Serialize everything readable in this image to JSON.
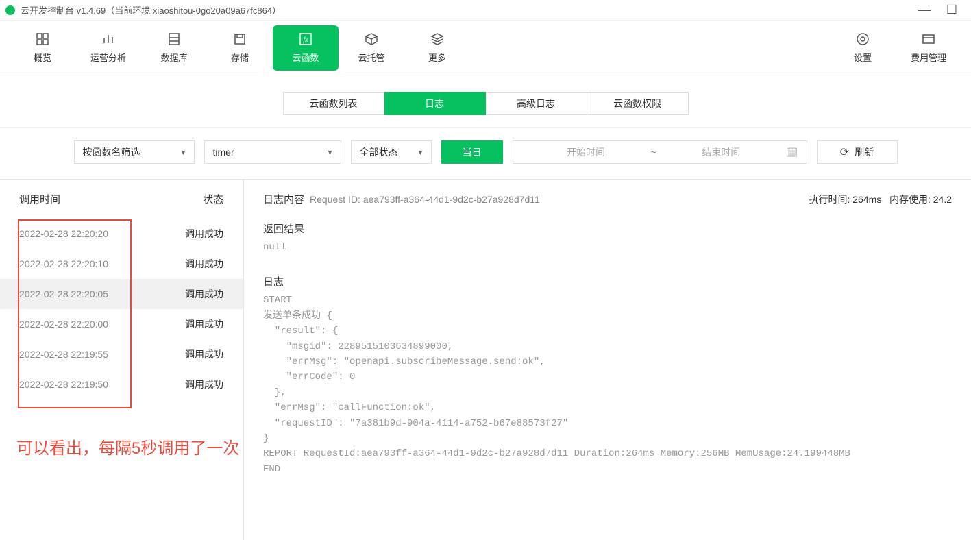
{
  "window": {
    "title": "云开发控制台 v1.4.69（当前环境 xiaoshitou-0go20a09a67fc864）"
  },
  "toolbar": {
    "items": [
      {
        "label": "概览",
        "icon": "grid"
      },
      {
        "label": "运营分析",
        "icon": "bars"
      },
      {
        "label": "数据库",
        "icon": "db"
      },
      {
        "label": "存储",
        "icon": "save"
      },
      {
        "label": "云函数",
        "icon": "fx",
        "active": true
      },
      {
        "label": "云托管",
        "icon": "cube"
      },
      {
        "label": "更多",
        "icon": "stack"
      }
    ],
    "right": [
      {
        "label": "设置",
        "icon": "gear"
      },
      {
        "label": "费用管理",
        "icon": "billing"
      }
    ]
  },
  "subtabs": [
    "云函数列表",
    "日志",
    "高级日志",
    "云函数权限"
  ],
  "subtab_active": 1,
  "filters": {
    "filter_by": "按函数名筛选",
    "function_name": "timer",
    "status": "全部状态",
    "today": "当日",
    "start_placeholder": "开始时间",
    "end_placeholder": "结束时间",
    "refresh": "刷新"
  },
  "sidebar": {
    "head_time": "调用时间",
    "head_status": "状态",
    "rows": [
      {
        "ts": "2022-02-28 22:20:20",
        "status": "调用成功"
      },
      {
        "ts": "2022-02-28 22:20:10",
        "status": "调用成功"
      },
      {
        "ts": "2022-02-28 22:20:05",
        "status": "调用成功",
        "selected": true
      },
      {
        "ts": "2022-02-28 22:20:00",
        "status": "调用成功"
      },
      {
        "ts": "2022-02-28 22:19:55",
        "status": "调用成功"
      },
      {
        "ts": "2022-02-28 22:19:50",
        "status": "调用成功"
      }
    ]
  },
  "annotation": "可以看出，每隔5秒调用了一次",
  "detail": {
    "log_content_label": "日志内容",
    "request_id_label": "Request ID: aea793ff-a364-44d1-9d2c-b27a928d7d11",
    "exec_time": "执行时间: 264ms",
    "mem_usage": "内存使用: 24.2",
    "return_label": "返回结果",
    "return_value": "null",
    "log_label": "日志",
    "log_body": "START\n发送单条成功 {\n  \"result\": {\n    \"msgid\": 2289515103634899000,\n    \"errMsg\": \"openapi.subscribeMessage.send:ok\",\n    \"errCode\": 0\n  },\n  \"errMsg\": \"callFunction:ok\",\n  \"requestID\": \"7a381b9d-904a-4114-a752-b67e88573f27\"\n}\nREPORT RequestId:aea793ff-a364-44d1-9d2c-b27a928d7d11 Duration:264ms Memory:256MB MemUsage:24.199448MB\nEND"
  }
}
